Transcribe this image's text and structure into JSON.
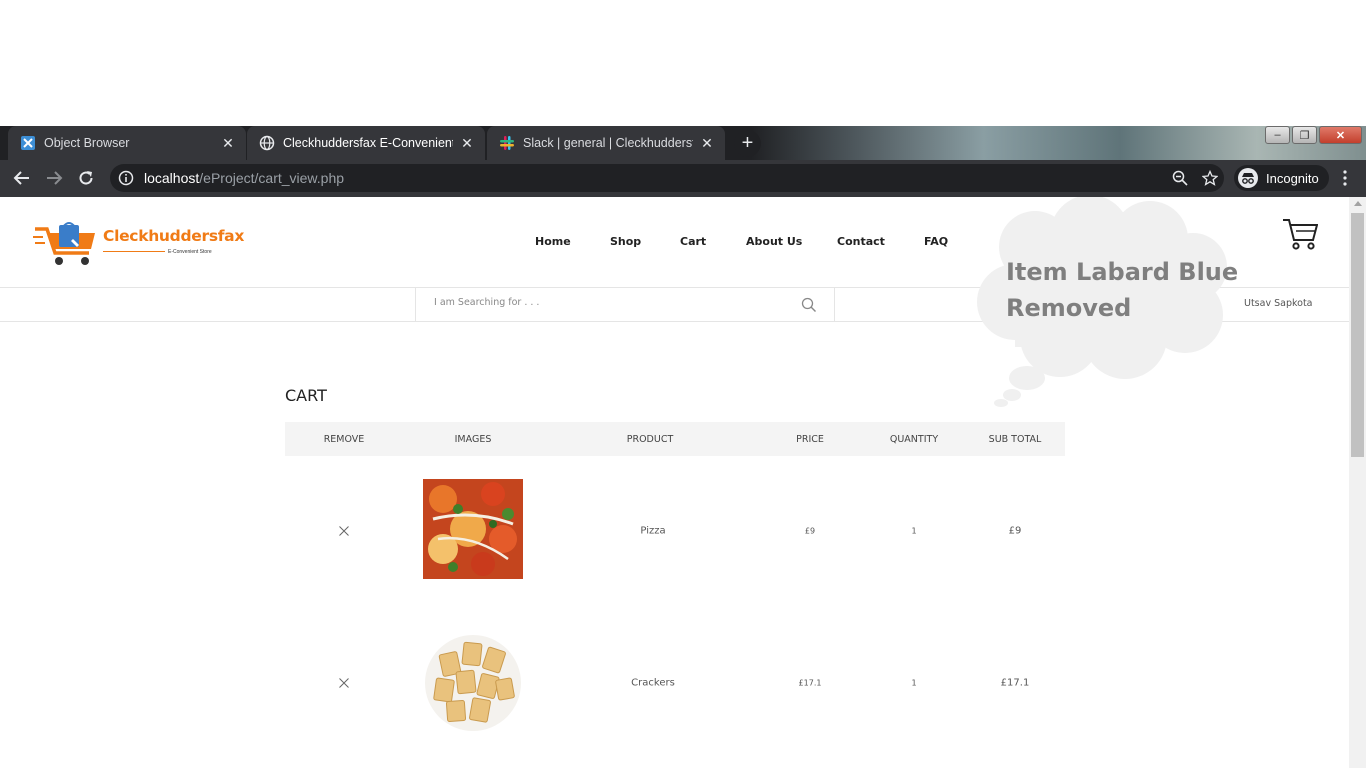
{
  "browser": {
    "tabs": [
      {
        "title": "Object Browser",
        "active": false,
        "icon": "object-browser-icon"
      },
      {
        "title": "Cleckhuddersfax E-Convenient St",
        "active": true,
        "icon": "globe-icon"
      },
      {
        "title": "Slack | general | Cleckhuddersfax",
        "active": false,
        "icon": "slack-icon"
      }
    ],
    "url_host": "localhost",
    "url_path": "/eProject/cart_view.php",
    "profile_label": "Incognito"
  },
  "site": {
    "brand": "Cleckhuddersfax",
    "tagline": "E-Convenient Store",
    "nav": [
      "Home",
      "Shop",
      "Cart",
      "About Us",
      "Contact",
      "FAQ"
    ],
    "search_placeholder": "I am Searching for . . .",
    "username": "Utsav Sapkota",
    "notification": "Item Labard Blue Removed",
    "notification_line1": "Item Labard Blue",
    "notification_line2": "Removed"
  },
  "cart": {
    "title": "CART",
    "columns": {
      "remove": "REMOVE",
      "images": "IMAGES",
      "product": "PRODUCT",
      "price": "PRICE",
      "quantity": "QUANTITY",
      "subtotal": "SUB TOTAL"
    },
    "items": [
      {
        "product": "Pizza",
        "price": "£9",
        "quantity": "1",
        "subtotal": "£9",
        "image": "pizza-image"
      },
      {
        "product": "Crackers",
        "price": "£17.1",
        "quantity": "1",
        "subtotal": "£17.1",
        "image": "crackers-image"
      }
    ]
  },
  "colors": {
    "brand_orange": "#f07b16",
    "chrome_dark": "#202124",
    "chrome_tab": "#35363a",
    "header_gray": "#f4f4f4"
  }
}
